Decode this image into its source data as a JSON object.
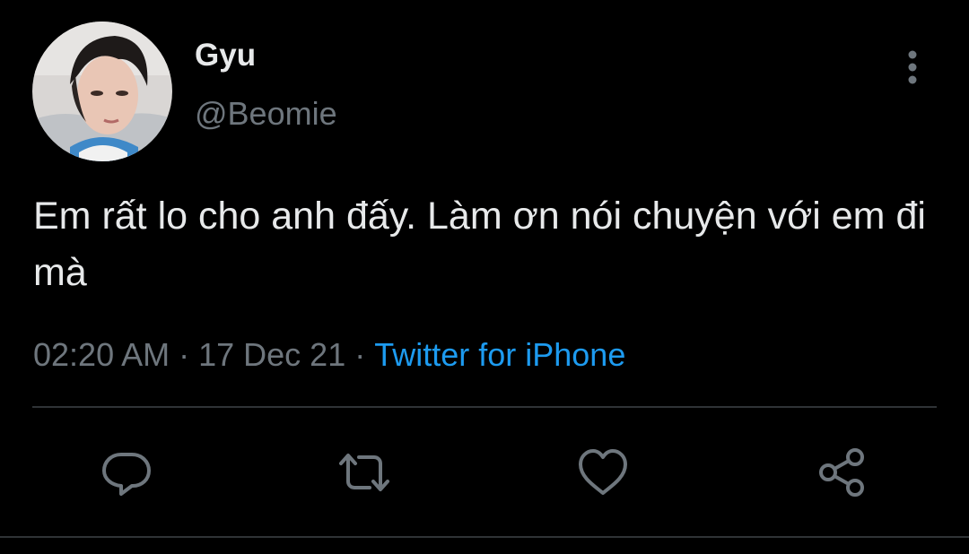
{
  "tweet": {
    "author": {
      "display_name": "Gyu",
      "handle": "@Beomie",
      "avatar_icon": "profile-photo"
    },
    "text": "Em rất lo cho anh đấy. Làm ơn nói chuyện với em đi mà",
    "time": "02:20 AM",
    "date": "17 Dec 21",
    "separator": "·",
    "source": "Twitter for iPhone"
  },
  "actions": {
    "reply_icon": "reply-icon",
    "retweet_icon": "retweet-icon",
    "like_icon": "heart-icon",
    "share_icon": "share-icon",
    "more_icon": "more-vertical-icon"
  },
  "colors": {
    "background": "#000000",
    "text": "#e7e9ea",
    "muted": "#6e767d",
    "link": "#1d9bf0",
    "divider": "#2f3336"
  }
}
